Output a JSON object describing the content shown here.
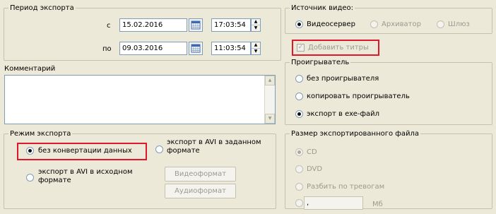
{
  "period": {
    "legend": "Период экспорта",
    "from_label": "с",
    "from_date": "15.02.2016",
    "from_time": "17:03:54",
    "to_label": "по",
    "to_date": "09.03.2016",
    "to_time": "11:03:54"
  },
  "comment": {
    "label": "Комментарий",
    "value": ""
  },
  "export_mode": {
    "legend": "Режим экспорта",
    "options": [
      {
        "label": "без конвертации данных",
        "checked": true
      },
      {
        "label_line1": "экспорт в AVI в заданном",
        "label_line2": "формате",
        "checked": false
      },
      {
        "label_line1": "экспорт в AVI в исходном",
        "label_line2": "формате",
        "checked": false
      }
    ],
    "video_format_button": "Видеоформат",
    "audio_format_button": "Аудиоформат"
  },
  "video_source": {
    "legend": "Источник видео:",
    "options": [
      {
        "label": "Видеосервер",
        "checked": true,
        "enabled": true
      },
      {
        "label": "Архиватор",
        "checked": false,
        "enabled": false
      },
      {
        "label": "Шлюз",
        "checked": false,
        "enabled": false
      }
    ]
  },
  "add_captions": {
    "label": "Добавить титры",
    "checked": true,
    "enabled": false
  },
  "player": {
    "legend": "Проигрыватель",
    "options": [
      {
        "label": "без проигрывателя",
        "checked": false
      },
      {
        "label": "копировать проигрыватель",
        "checked": false
      },
      {
        "label": "экспорт в exe-файл",
        "checked": true
      }
    ]
  },
  "file_size": {
    "legend": "Размер экспортированного файла",
    "options": [
      {
        "label": "CD",
        "checked": true
      },
      {
        "label": "DVD",
        "checked": false
      },
      {
        "label": "Разбить по тревогам",
        "checked": false
      }
    ],
    "custom_value": ",",
    "unit": "Мб"
  },
  "colors": {
    "highlight": "#e0162b",
    "field_border": "#7f9db9",
    "dialog_bg": "#ece9d8"
  },
  "icons": {
    "calendar": "calendar-icon",
    "spin_up": "spin-up-icon",
    "spin_down": "spin-down-icon"
  }
}
